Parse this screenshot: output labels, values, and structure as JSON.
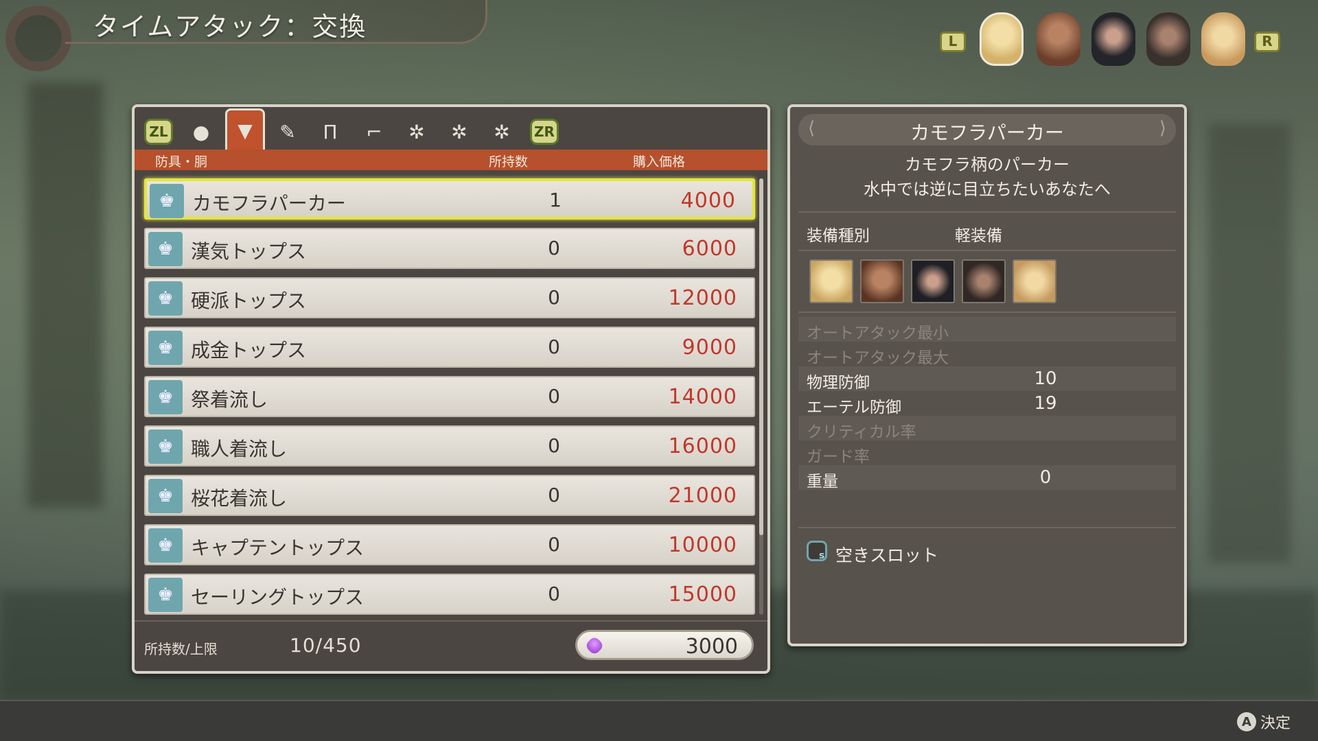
{
  "title": "タイムアタック：交換",
  "party": {
    "left_button": "L",
    "right_button": "R",
    "members": [
      {
        "icon": "shulk-face-icon",
        "color": "#e6cf8b"
      },
      {
        "icon": "reyn-face-icon",
        "color": "#7a4a33"
      },
      {
        "icon": "dunban-face-icon",
        "color": "#2f2f36"
      },
      {
        "icon": "dickson-face-icon",
        "color": "#3d3430"
      },
      {
        "icon": "riki-face-icon",
        "color": "#e8c98c"
      }
    ]
  },
  "tabs": {
    "left_btn": "ZL",
    "right_btn": "ZR",
    "items": [
      {
        "icon": "head-icon",
        "glyph": "👤"
      },
      {
        "icon": "body-armor-icon",
        "glyph": "👕",
        "active": true
      },
      {
        "icon": "arm-armor-icon",
        "glyph": "🖐"
      },
      {
        "icon": "leg-armor-icon",
        "glyph": "👖"
      },
      {
        "icon": "foot-armor-icon",
        "glyph": "👢"
      },
      {
        "icon": "gem-1-icon",
        "glyph": "⚙"
      },
      {
        "icon": "gem-2-icon",
        "glyph": "⚙"
      },
      {
        "icon": "gem-3-icon",
        "glyph": "⚙"
      }
    ]
  },
  "columns": {
    "category": "防具・胴",
    "owned": "所持数",
    "price": "購入価格"
  },
  "items": [
    {
      "name": "カモフラパーカー",
      "owned": "1",
      "price": "4000"
    },
    {
      "name": "漢気トップス",
      "owned": "0",
      "price": "6000"
    },
    {
      "name": "硬派トップス",
      "owned": "0",
      "price": "12000"
    },
    {
      "name": "成金トップス",
      "owned": "0",
      "price": "9000"
    },
    {
      "name": "祭着流し",
      "owned": "0",
      "price": "14000"
    },
    {
      "name": "職人着流し",
      "owned": "0",
      "price": "16000"
    },
    {
      "name": "桜花着流し",
      "owned": "0",
      "price": "21000"
    },
    {
      "name": "キャプテントップス",
      "owned": "0",
      "price": "10000"
    },
    {
      "name": "セーリングトップス",
      "owned": "0",
      "price": "15000"
    }
  ],
  "footer": {
    "capacity_label": "所持数/上限",
    "capacity_value": "10/450",
    "currency_value": "3000"
  },
  "detail": {
    "title": "カモフラパーカー",
    "description_1": "カモフラ柄のパーカー",
    "description_2": "水中では逆に目立ちたいあなたへ",
    "eq_type_label": "装備種別",
    "eq_type_value": "軽装備",
    "stats": [
      {
        "label": "オートアタック最小",
        "value": "",
        "dim": true
      },
      {
        "label": "オートアタック最大",
        "value": "",
        "dim": true
      },
      {
        "label": "物理防御",
        "value": "10",
        "dim": false
      },
      {
        "label": "エーテル防御",
        "value": "19",
        "dim": false
      },
      {
        "label": "クリティカル率",
        "value": "",
        "dim": true
      },
      {
        "label": "ガード率",
        "value": "",
        "dim": true
      },
      {
        "label": "重量",
        "value": "0",
        "dim": false
      }
    ],
    "slot_label": "空きスロット"
  },
  "bottom": {
    "confirm_button": "A",
    "confirm_label": "決定"
  }
}
